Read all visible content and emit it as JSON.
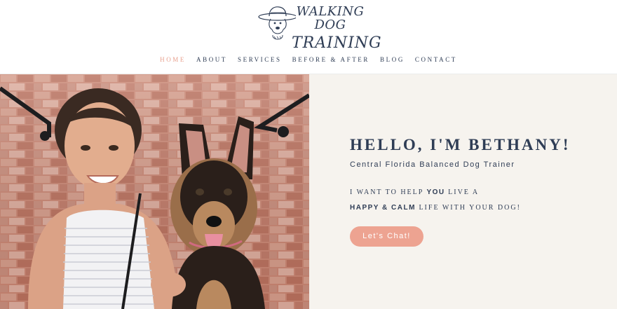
{
  "brand": {
    "line1": "WALKING DOG",
    "line2": "TRAINING",
    "logo_icon": "dog-with-hat-illustration"
  },
  "nav": {
    "items": [
      {
        "label": "HOME",
        "active": true
      },
      {
        "label": "ABOUT",
        "active": false
      },
      {
        "label": "SERVICES",
        "active": false
      },
      {
        "label": "BEFORE & AFTER",
        "active": false
      },
      {
        "label": "BLOG",
        "active": false
      },
      {
        "label": "CONTACT",
        "active": false
      }
    ]
  },
  "hero": {
    "greeting": "HELLO, I'M BETHANY!",
    "subtitle": "Central Florida Balanced Dog Trainer",
    "tagline": {
      "line1_pre": "I WANT TO HELP ",
      "line1_bold": "YOU",
      "line1_post": " LIVE A",
      "line2_bold": "HAPPY & CALM",
      "line2_post": " LIFE WITH YOUR DOG!"
    },
    "cta_label": "Let's Chat!",
    "photo_subject": "woman-with-german-shepherd-puppy-photo"
  },
  "colors": {
    "navy": "#2f3d55",
    "accent": "#eda391",
    "nav_active": "#e8a08e",
    "panel_bg": "#f6f3ee"
  }
}
